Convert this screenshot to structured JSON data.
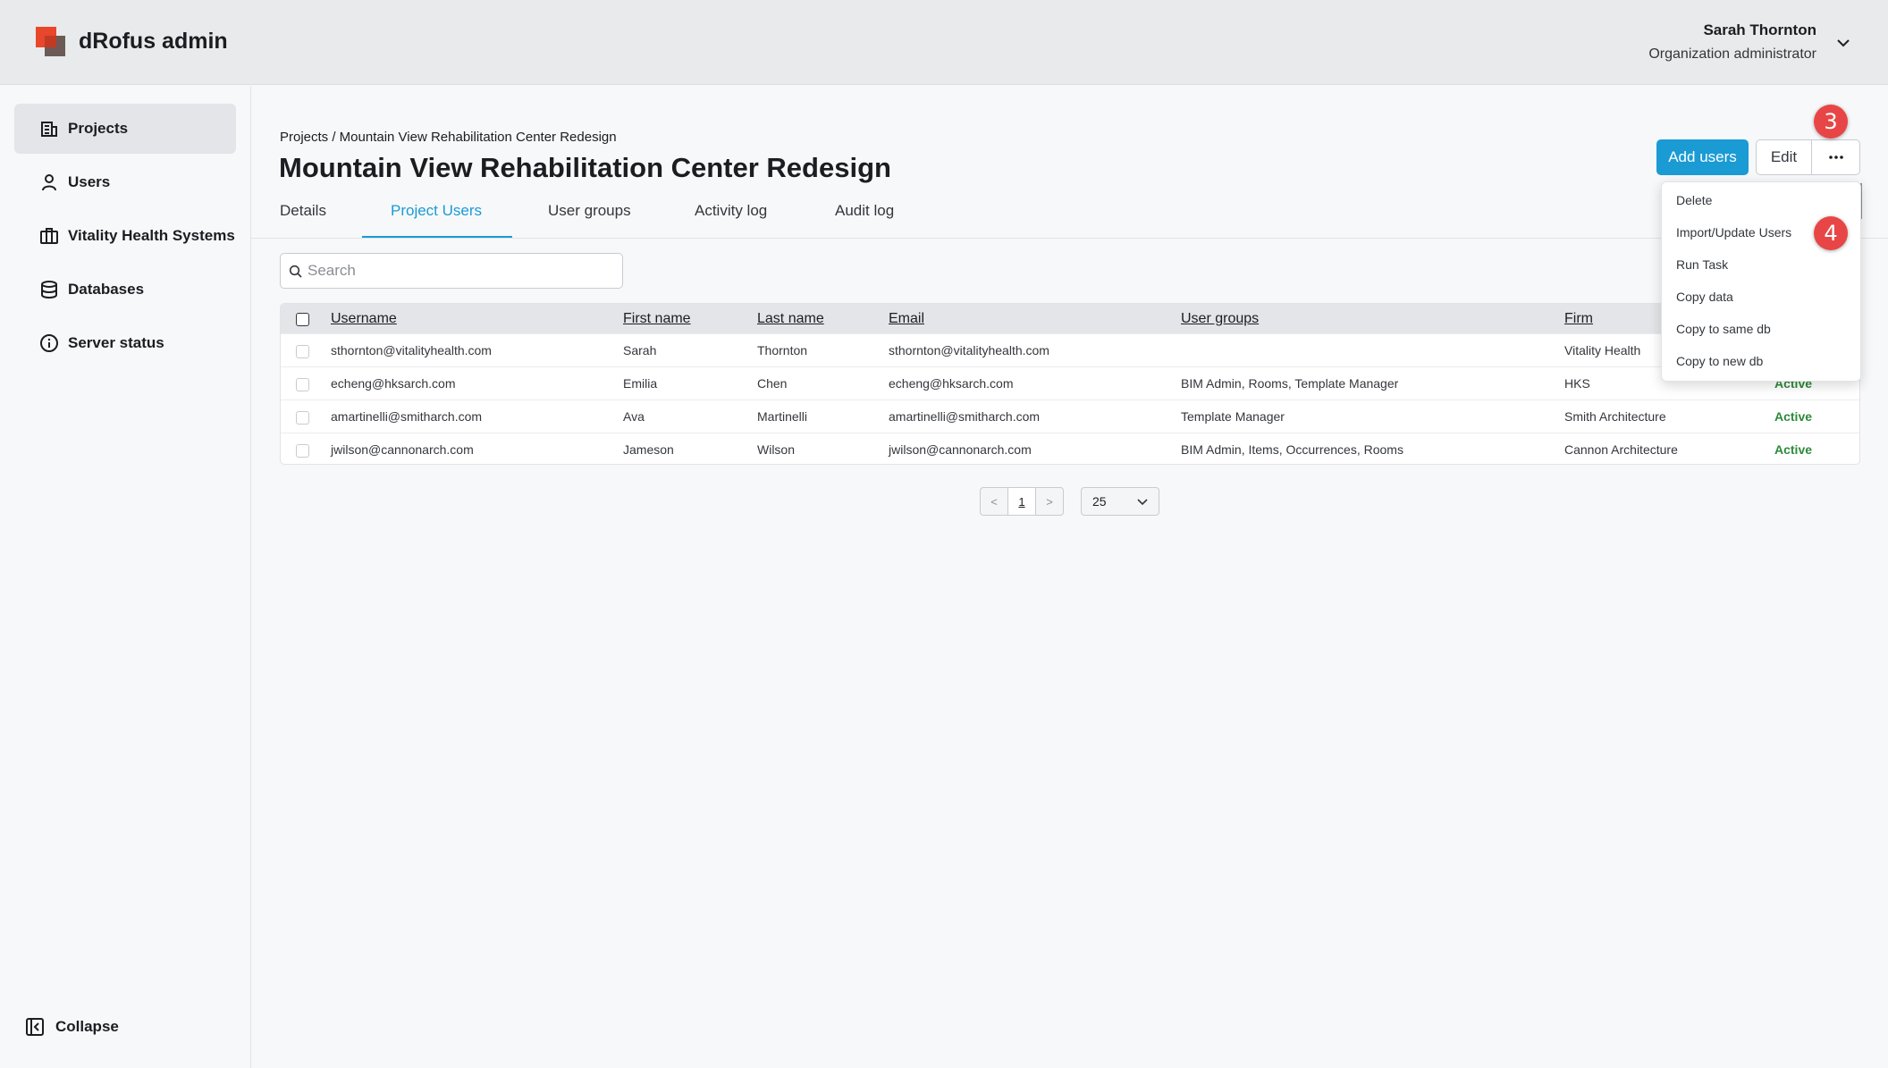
{
  "app": {
    "title": "dRofus admin"
  },
  "user": {
    "name": "Sarah Thornton",
    "role": "Organization administrator"
  },
  "sidebar": {
    "items": [
      {
        "label": "Projects",
        "icon": "building-icon",
        "active": true
      },
      {
        "label": "Users",
        "icon": "user-icon",
        "active": false
      },
      {
        "label": "Vitality Health Systems",
        "icon": "briefcase-icon",
        "active": false
      },
      {
        "label": "Databases",
        "icon": "database-icon",
        "active": false
      },
      {
        "label": "Server status",
        "icon": "info-icon",
        "active": false
      }
    ],
    "collapse_label": "Collapse"
  },
  "header": {
    "breadcrumb": "Projects / Mountain View Rehabilitation Center Redesign",
    "title": "Mountain View Rehabilitation Center Redesign",
    "add_users_label": "Add users",
    "edit_label": "Edit"
  },
  "tabs": [
    "Details",
    "Project Users",
    "User groups",
    "Activity log",
    "Audit log"
  ],
  "active_tab": "Project Users",
  "badges": {
    "more_menu": "3",
    "import_item": "4"
  },
  "menu": {
    "items": [
      "Delete",
      "Import/Update Users",
      "Run Task",
      "Copy data",
      "Copy to same db",
      "Copy to new db"
    ]
  },
  "search": {
    "placeholder": "Search",
    "value": ""
  },
  "table": {
    "columns": [
      "Username",
      "First name",
      "Last name",
      "Email",
      "User groups",
      "Firm"
    ],
    "rows": [
      {
        "username": "sthornton@vitalityhealth.com",
        "first": "Sarah",
        "last": "Thornton",
        "email": "sthornton@vitalityhealth.com",
        "groups": "",
        "firm": "Vitality Health",
        "status": ""
      },
      {
        "username": "echeng@hksarch.com",
        "first": "Emilia",
        "last": "Chen",
        "email": "echeng@hksarch.com",
        "groups": "BIM Admin, Rooms, Template Manager",
        "firm": "HKS",
        "status": "Active"
      },
      {
        "username": "amartinelli@smitharch.com",
        "first": "Ava",
        "last": "Martinelli",
        "email": "amartinelli@smitharch.com",
        "groups": "Template Manager",
        "firm": "Smith Architecture",
        "status": "Active"
      },
      {
        "username": "jwilson@cannonarch.com",
        "first": "Jameson",
        "last": "Wilson",
        "email": "jwilson@cannonarch.com",
        "groups": "BIM Admin, Items, Occurrences, Rooms",
        "firm": "Cannon Architecture",
        "status": "Active"
      }
    ]
  },
  "pagination": {
    "prev": "<",
    "page": "1",
    "next": ">",
    "page_size": "25"
  },
  "colors": {
    "accent": "#1a9bd4",
    "status_active": "#2d8a3a",
    "badge": "#e84646",
    "brand": "#e8472b"
  }
}
